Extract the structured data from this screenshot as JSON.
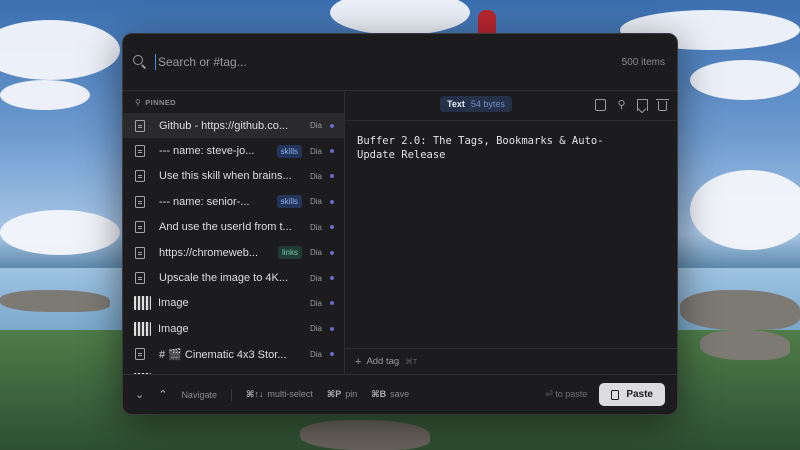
{
  "search": {
    "placeholder": "Search or #tag...",
    "count": "500 items"
  },
  "list": {
    "pinned_label": "PINNED",
    "items": [
      {
        "kind": "text",
        "label": "Github - https://github.co...",
        "tag": "",
        "source": "Dia",
        "selected": true
      },
      {
        "kind": "text",
        "label": "--- name: steve-jo...",
        "tag": "skills",
        "source": "Dia"
      },
      {
        "kind": "text",
        "label": "Use this skill when brains...",
        "tag": "",
        "source": "Dia"
      },
      {
        "kind": "text",
        "label": "--- name: senior-...",
        "tag": "skills",
        "source": "Dia"
      },
      {
        "kind": "text",
        "label": "And use the userId from t...",
        "tag": "",
        "source": "Dia"
      },
      {
        "kind": "text",
        "label": "https://chromeweb...",
        "tag": "links",
        "source": "Dia"
      },
      {
        "kind": "text",
        "label": "Upscale the image to 4K...",
        "tag": "",
        "source": "Dia"
      },
      {
        "kind": "image",
        "label": "Image",
        "tag": "",
        "source": "Dia"
      },
      {
        "kind": "image",
        "label": "Image",
        "tag": "",
        "source": "Dia"
      },
      {
        "kind": "text",
        "label": "# 🎬 Cinematic 4x3 Stor...",
        "tag": "",
        "source": "Dia"
      },
      {
        "kind": "image",
        "label": "I",
        "tag": "",
        "source": ""
      }
    ]
  },
  "preview": {
    "type": "Text",
    "size": "54 bytes",
    "content": "Buffer 2.0: The Tags, Bookmarks & Auto-\nUpdate Release",
    "add_tag_label": "Add tag",
    "add_tag_shortcut": "⌘T",
    "icons": [
      "copy-icon",
      "pin-icon",
      "bookmark-icon",
      "trash-icon"
    ]
  },
  "footer": {
    "navigate_label": "Navigate",
    "multiselect_keys": "⌘↑↓",
    "multiselect_label": "multi-select",
    "pin_keys": "⌘P",
    "pin_label": "pin",
    "save_keys": "⌘B",
    "save_label": "save",
    "to_paste_label": "⏎ to paste",
    "paste_label": "Paste"
  },
  "colors": {
    "accent": "#4a8ef5",
    "tag_skills": "#8fb2ef",
    "tag_links": "#6fcaa5",
    "dot": "#6e6ac8"
  }
}
